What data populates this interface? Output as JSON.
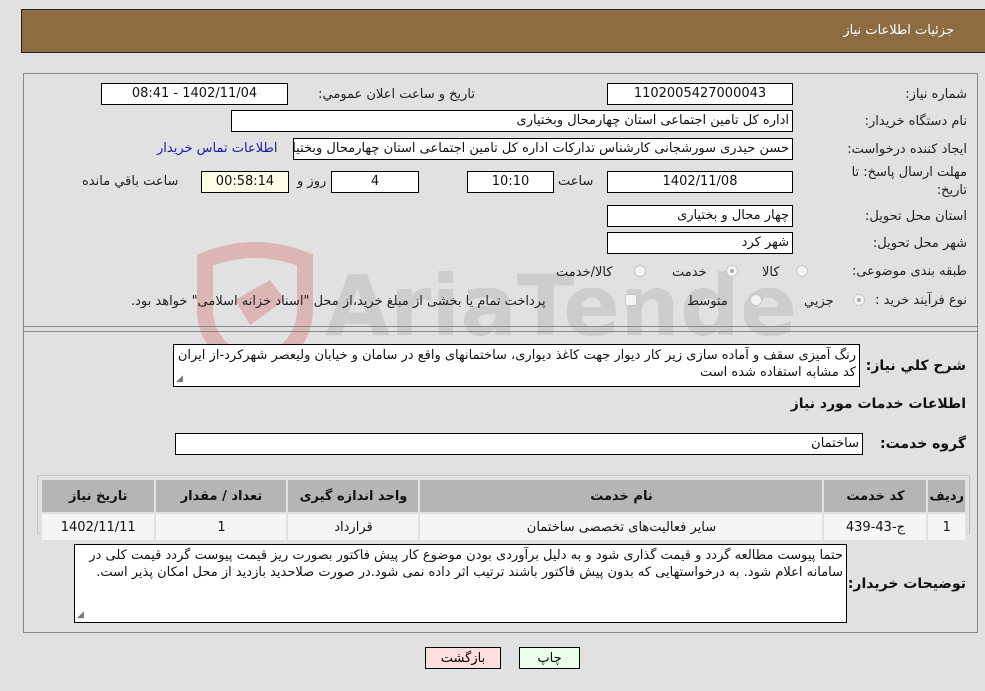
{
  "header": {
    "title": "جزئیات اطلاعات نیاز"
  },
  "fields": {
    "need_number": {
      "label": "شماره نیاز:",
      "value": "1102005427000043"
    },
    "announce_datetime": {
      "label": "تاریخ و ساعت اعلان عمومي:",
      "value": "1402/11/04 - 08:41"
    },
    "buyer_org": {
      "label": "نام دستگاه خریدار:",
      "value": "اداره کل تامین اجتماعی استان چهارمحال وبختیاری"
    },
    "requester": {
      "label": "ایجاد کننده درخواست:",
      "value": "حسن حیدری سورشجانی کارشناس تدارکات اداره کل تامین اجتماعی استان چهارمحال وبختیاری"
    },
    "buyer_contact_link": "اطلاعات تماس خریدار",
    "deadline": {
      "label_line1": "مهلت ارسال پاسخ: تا",
      "label_line2": "تاریخ:",
      "date": "1402/11/08",
      "time_label": "ساعت",
      "time": "10:10",
      "days": "4",
      "days_label": "روز و",
      "remaining": "00:58:14",
      "remaining_label": "ساعت باقي مانده"
    },
    "province": {
      "label": "استان محل تحویل:",
      "value": "چهار محال و بختیاری"
    },
    "city": {
      "label": "شهر محل تحویل:",
      "value": "شهر کرد"
    },
    "category": {
      "label": "طبقه بندی موضوعی:",
      "options": [
        {
          "label": "کالا",
          "checked": false
        },
        {
          "label": "خدمت",
          "checked": true
        },
        {
          "label": "کالا/خدمت",
          "checked": false
        }
      ]
    },
    "purchase_type": {
      "label": "نوع فرآیند خرید :",
      "options": [
        {
          "label": "جزيي",
          "checked": true
        },
        {
          "label": "متوسط",
          "checked": false
        }
      ],
      "treasury_checkbox_label": "پرداخت تمام یا بخشی از مبلغ خرید،از محل \"اسناد خزانه اسلامی\" خواهد بود."
    }
  },
  "description": {
    "label": "شرح کلي نیاز:",
    "value": "رنگ آمیزی سقف و آماده سازی زیر کار دیوار جهت کاغذ دیواری، ساختمانهای واقع در سامان و خیابان ولیعصر شهرکرد-از ایران کد مشابه استفاده شده است"
  },
  "services_section": {
    "title": "اطلاعات خدمات مورد نیاز",
    "group_label": "گروه خدمت:",
    "group_value": "ساختمان",
    "table": {
      "headers": [
        "ردیف",
        "کد خدمت",
        "نام خدمت",
        "واحد اندازه گیری",
        "تعداد / مقدار",
        "تاریخ نیاز"
      ],
      "rows": [
        [
          "1",
          "ج-43-439",
          "سایر فعالیت‌های تخصصی ساختمان",
          "قرارداد",
          "1",
          "1402/11/11"
        ]
      ]
    }
  },
  "buyer_notes": {
    "label": "توضیحات خریدار:",
    "value": "حتما پیوست مطالعه گردد و قیمت گذاری شود و به دلیل برآوردی بودن موضوع کار پیش فاکتور بصورت ریز قیمت پیوست گردد قیمت کلی در سامانه اعلام شود. به درخواستهایی که بدون پیش فاکتور باشند ترتیب اثر داده نمی شود.در صورت صلاحدید بازدید از محل امکان پذیر است."
  },
  "buttons": {
    "print": "چاپ",
    "back": "بازگشت"
  },
  "watermark": {
    "text": "AriaTender.neT"
  },
  "colors": {
    "header_bg": "#8d6c41",
    "page_bg": "#e1e1e1",
    "print_btn_bg": "#eaffea",
    "back_btn_bg": "#ffdede",
    "link": "#1a1aa6",
    "remaining_bg": "#fffde8"
  }
}
